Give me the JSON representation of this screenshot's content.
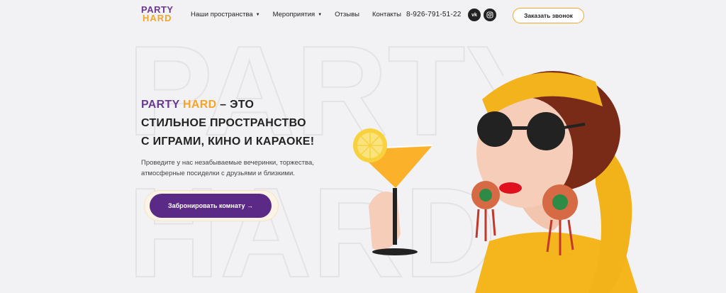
{
  "logo": {
    "line1": "PARTY",
    "line2": "HARD"
  },
  "nav": {
    "items": [
      {
        "label": "Наши пространства",
        "caret": "▼"
      },
      {
        "label": "Мероприятия",
        "caret": "▼"
      },
      {
        "label": "Отзывы",
        "caret": ""
      },
      {
        "label": "Контакты",
        "caret": ""
      }
    ]
  },
  "contact": {
    "phone": "8-926-791-51-22"
  },
  "social": {
    "vk": "vk",
    "ig": "ig"
  },
  "header": {
    "call_button": "Заказать звонок"
  },
  "hero": {
    "brand_part1": "PARTY",
    "brand_part2": "HARD",
    "title_rest1": " – ЭТО",
    "title_line2": "СТИЛЬНОЕ ПРОСТРАНСТВО",
    "title_line3": "С ИГРАМИ, КИНО И КАРАОКЕ!",
    "description": "Проведите у нас незабываемые вечеринки, торжества, атмосферные посиделки с друзьями и близкими.",
    "cta": "Забронировать комнату →",
    "watermark_text": "PARTY HARD"
  },
  "colors": {
    "brand_purple": "#6a3a93",
    "brand_orange": "#f4a52c",
    "cta_purple": "#5a2a86"
  }
}
